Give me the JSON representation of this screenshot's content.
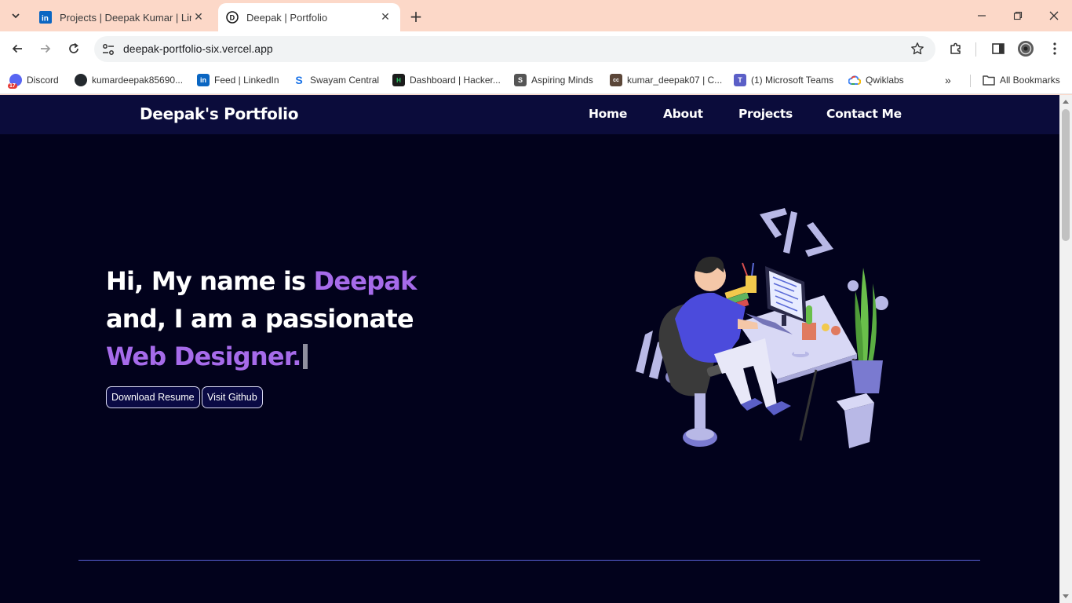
{
  "browser": {
    "tabs": [
      {
        "title": "Projects | Deepak Kumar | LinkedIn",
        "favicon": "linkedin-icon",
        "active": false
      },
      {
        "title": "Deepak | Portfolio",
        "favicon": "vercel-icon",
        "active": true
      }
    ],
    "url": "deepak-portfolio-six.vercel.app",
    "bookmarks": [
      {
        "label": "Discord",
        "icon": "discord-icon",
        "color": "#5865f2"
      },
      {
        "label": "kumardeepak85690...",
        "icon": "github-icon",
        "color": "#24292e"
      },
      {
        "label": "Feed | LinkedIn",
        "icon": "linkedin-icon",
        "color": "#0a66c2"
      },
      {
        "label": "Swayam Central",
        "icon": "swayam-icon",
        "color": "#1a73e8"
      },
      {
        "label": "Dashboard | Hacker...",
        "icon": "hackerrank-icon",
        "color": "#1b1b1b"
      },
      {
        "label": "Aspiring Minds",
        "icon": "aspiring-minds-icon",
        "color": "#555555"
      },
      {
        "label": "kumar_deepak07 | C...",
        "icon": "codechef-icon",
        "color": "#5b4638"
      },
      {
        "label": "(1) Microsoft Teams",
        "icon": "teams-icon",
        "color": "#5b5fc7"
      },
      {
        "label": "Qwiklabs",
        "icon": "google-cloud-icon",
        "color": "#4285f4"
      }
    ],
    "all_bookmarks_label": "All Bookmarks",
    "discord_badge": "17"
  },
  "site": {
    "brand": "Deepak's Portfolio",
    "nav": [
      "Home",
      "About",
      "Projects",
      "Contact Me"
    ],
    "hero": {
      "line1_prefix": "Hi, My name is ",
      "line1_name": "Deepak",
      "line2": "and, I am a passionate",
      "line3": "Web Designer."
    },
    "buttons": {
      "resume": "Download Resume",
      "github": "Visit Github"
    },
    "colors": {
      "nav_bg": "#0b0c3b",
      "page_bg": "#02021c",
      "accent": "#a66bea",
      "divider": "#5a62d8"
    }
  }
}
